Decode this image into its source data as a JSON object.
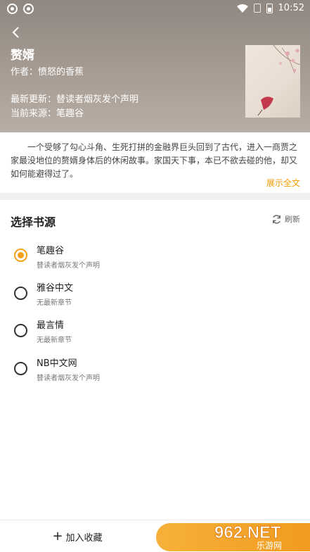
{
  "status_bar": {
    "time": "10:52"
  },
  "book": {
    "title": "赘婿",
    "author": "作者：愤怒的香蕉",
    "latest": "最新更新：替读者烟灰发个声明",
    "source": "当前来源：笔趣谷",
    "synopsis": "一个受够了勾心斗角、生死打拼的金融界巨头回到了古代，进入一商贾之家最没地位的赘婿身体后的休闲故事。家国天下事，本已不欲去碰的他，却又如何能避得过了。",
    "show_all": "展示全文"
  },
  "section": {
    "title": "选择书源",
    "refresh": "刷新"
  },
  "sources": [
    {
      "name": "笔趣谷",
      "latest": "替读者烟灰发个声明",
      "selected": true
    },
    {
      "name": "雅谷中文",
      "latest": "无最新章节",
      "selected": false
    },
    {
      "name": "最言情",
      "latest": "无最新章节",
      "selected": false
    },
    {
      "name": "NB中文网",
      "latest": "替读者烟灰发个声明",
      "selected": false
    }
  ],
  "bottom": {
    "add_label": "加入收藏",
    "read_label": ""
  },
  "watermark": {
    "text": "962.NET",
    "sub": "乐游网"
  },
  "colors": {
    "accent": "#f3a21c",
    "header_bg": "#a29890",
    "show_all": "#f29a00"
  }
}
